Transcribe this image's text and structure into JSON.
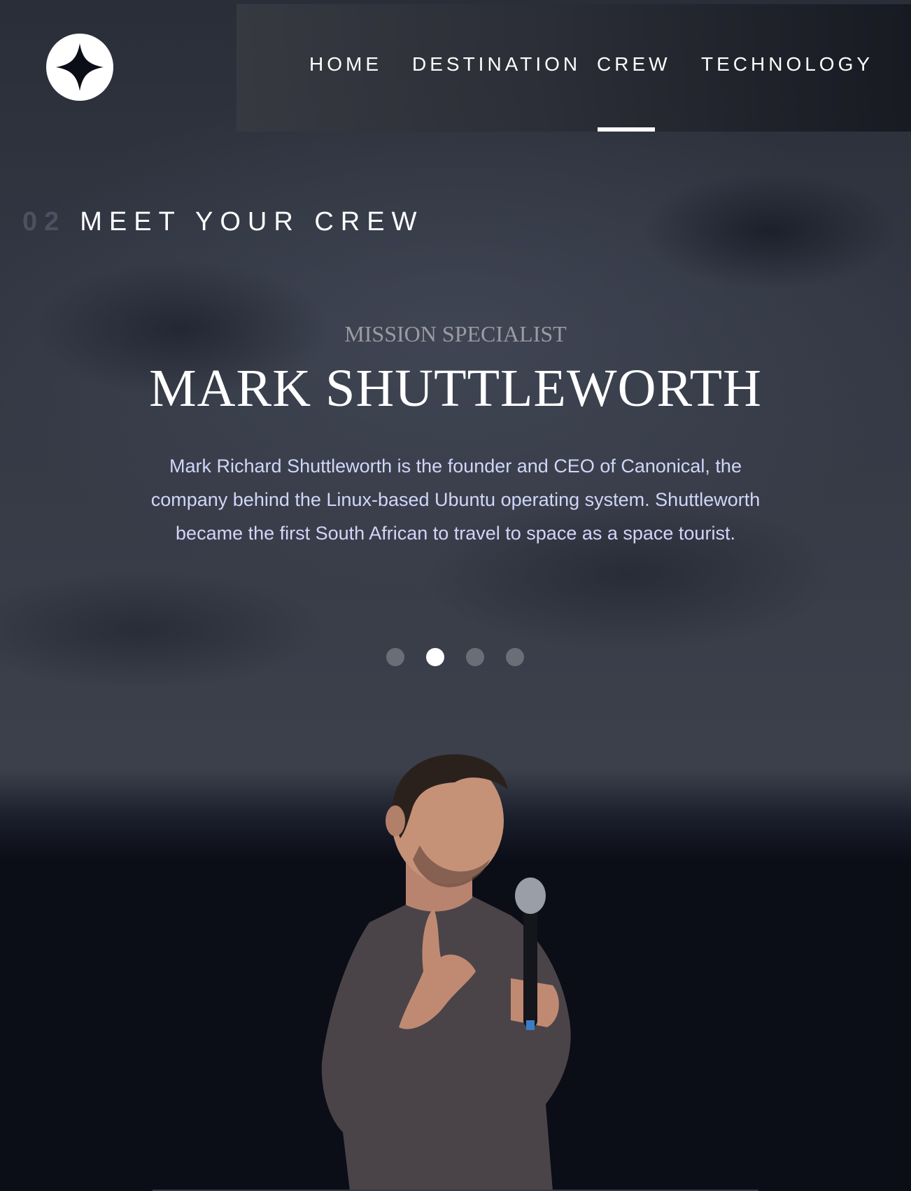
{
  "nav": {
    "logo_icon": "star-logo-icon",
    "items": [
      {
        "label": "HOME"
      },
      {
        "label": "DESTINATION"
      },
      {
        "label": "CREW"
      },
      {
        "label": "TECHNOLOGY"
      }
    ],
    "active": "CREW"
  },
  "page": {
    "number": "02",
    "title": "MEET YOUR CREW"
  },
  "crew": {
    "role": "MISSION SPECIALIST",
    "name": "MARK SHUTTLEWORTH",
    "bio": "Mark Richard Shuttleworth is the founder and CEO of Canonical, the company behind the Linux-based Ubuntu operating system. Shuttleworth became the first South African to travel to space as a space tourist.",
    "slide_count": 4,
    "active_slide": 2,
    "photo_icon": "crew-member-photo"
  },
  "colors": {
    "background": "#0b0d17",
    "text_light": "#d0d6f9",
    "muted": "#9a9ba3",
    "accent": "#ffffff"
  }
}
